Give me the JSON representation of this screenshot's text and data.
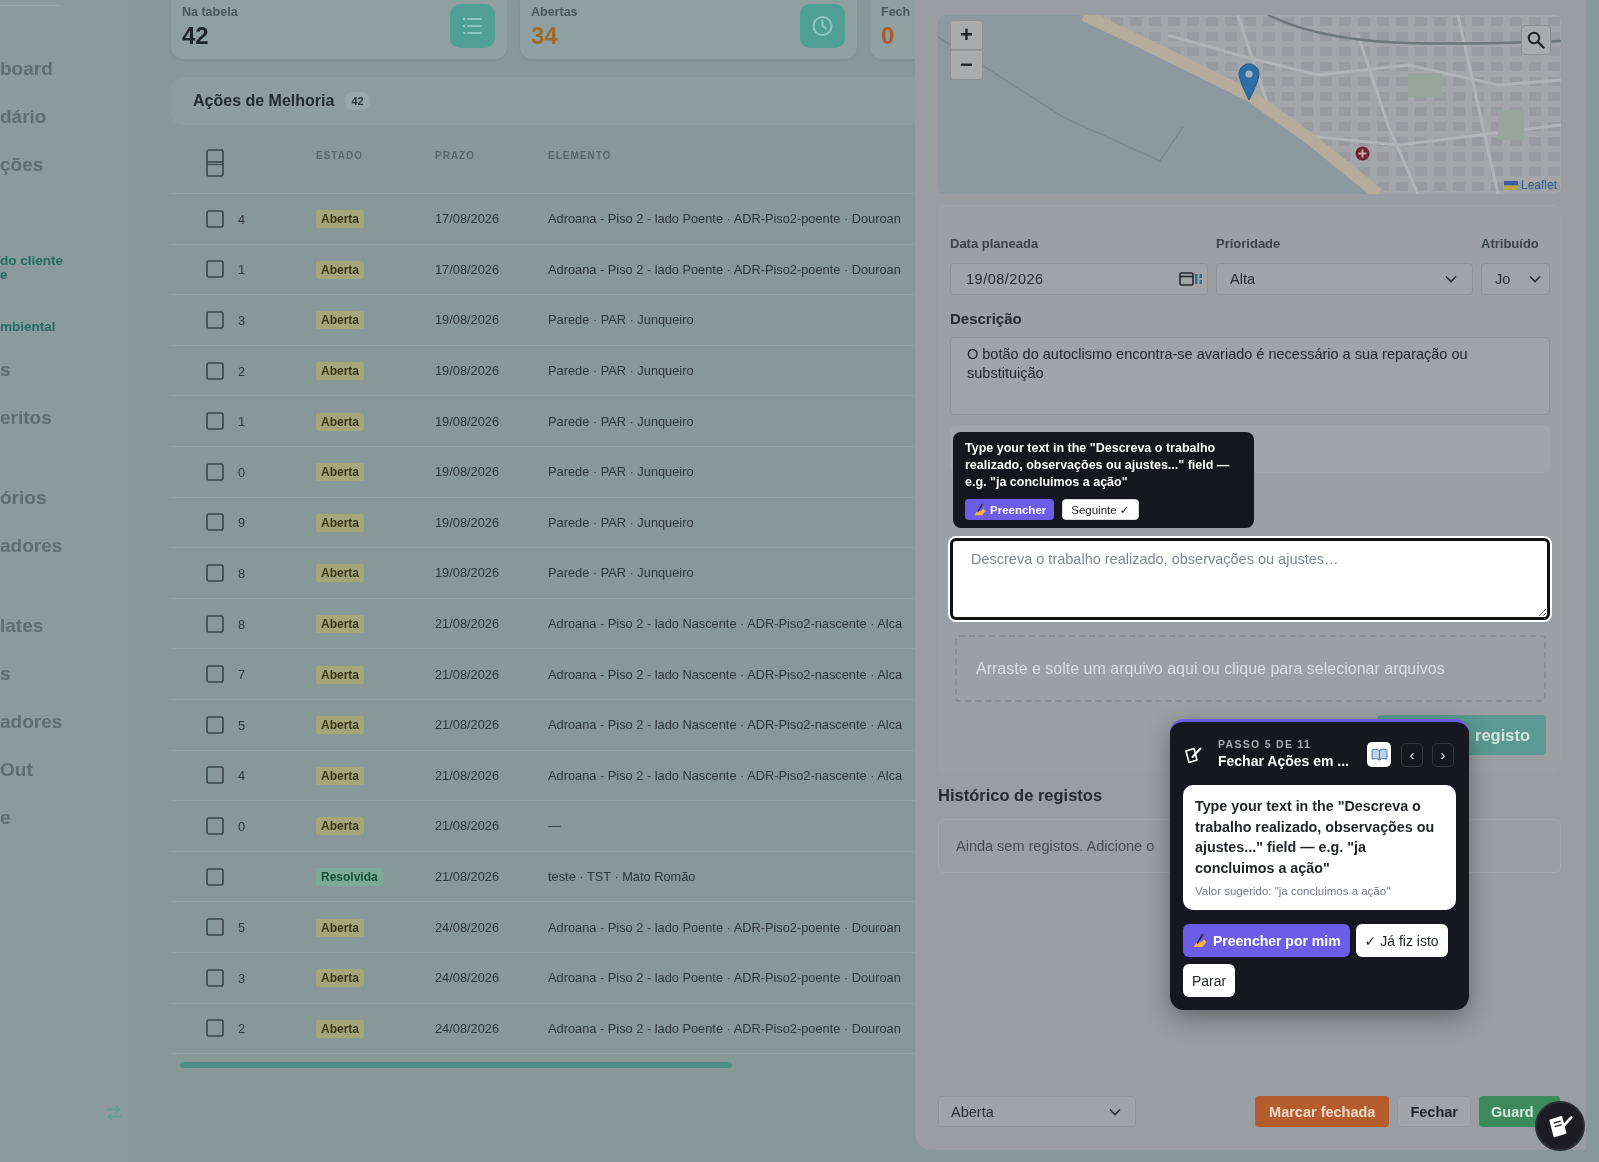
{
  "sidebar": {
    "groups": [
      {
        "items": [
          {
            "kind": "main",
            "lines": [
              "board"
            ]
          },
          {
            "kind": "main",
            "lines": [
              "dário"
            ]
          },
          {
            "kind": "main",
            "lines": [
              "ções"
            ]
          }
        ]
      },
      {
        "items": [
          {
            "kind": "sub",
            "lines": [
              "do cliente",
              "e"
            ]
          },
          {
            "kind": "sub",
            "lines": [
              "mbiental"
            ]
          },
          {
            "kind": "main",
            "lines": [
              "s"
            ]
          },
          {
            "kind": "main",
            "lines": [
              "eritos"
            ]
          }
        ]
      },
      {
        "items": [
          {
            "kind": "main",
            "lines": [
              "órios"
            ]
          },
          {
            "kind": "main",
            "lines": [
              "adores"
            ]
          }
        ]
      },
      {
        "items": [
          {
            "kind": "main",
            "lines": [
              "lates"
            ]
          },
          {
            "kind": "main",
            "lines": [
              "s"
            ]
          },
          {
            "kind": "main",
            "lines": [
              "adores"
            ]
          },
          {
            "kind": "main",
            "lines": [
              "Out"
            ]
          },
          {
            "kind": "main",
            "lines": [
              "e"
            ]
          }
        ]
      }
    ]
  },
  "stats": [
    {
      "kind": "total",
      "label": "Na tabela",
      "value": "42"
    },
    {
      "kind": "open",
      "label": "Abertas",
      "value": "34"
    },
    {
      "kind": "closed",
      "label": "Fech",
      "value": "0"
    }
  ],
  "actions": {
    "title": "Ações de Melhoria",
    "count": "42",
    "table": {
      "select_all_checked": false,
      "columns": [
        "ESTADO",
        "PRAZO",
        "ELEMENTO"
      ],
      "rows": [
        {
          "id": "4",
          "checked": false,
          "status": {
            "label": "Aberta",
            "kind": "open"
          },
          "due": "17/08/2026",
          "element": "Adroana - Piso 2 - lado Poente · ADR-Piso2-poente · Douroan"
        },
        {
          "id": "1",
          "checked": false,
          "status": {
            "label": "Aberta",
            "kind": "open"
          },
          "due": "17/08/2026",
          "element": "Adroana - Piso 2 - lado Poente · ADR-Piso2-poente · Douroan"
        },
        {
          "id": "3",
          "checked": false,
          "status": {
            "label": "Aberta",
            "kind": "open"
          },
          "due": "19/08/2026",
          "element": "Parede · PAR · Junqueiro"
        },
        {
          "id": "2",
          "checked": false,
          "status": {
            "label": "Aberta",
            "kind": "open"
          },
          "due": "19/08/2026",
          "element": "Parede · PAR · Junqueiro"
        },
        {
          "id": "1",
          "checked": false,
          "status": {
            "label": "Aberta",
            "kind": "open"
          },
          "due": "19/08/2026",
          "element": "Parede · PAR · Junqueiro"
        },
        {
          "id": "0",
          "checked": false,
          "status": {
            "label": "Aberta",
            "kind": "open"
          },
          "due": "19/08/2026",
          "element": "Parede · PAR · Junqueiro"
        },
        {
          "id": "9",
          "checked": false,
          "status": {
            "label": "Aberta",
            "kind": "open"
          },
          "due": "19/08/2026",
          "element": "Parede · PAR · Junqueiro"
        },
        {
          "id": "8",
          "checked": false,
          "status": {
            "label": "Aberta",
            "kind": "open"
          },
          "due": "19/08/2026",
          "element": "Parede · PAR · Junqueiro"
        },
        {
          "id": "8",
          "checked": false,
          "status": {
            "label": "Aberta",
            "kind": "open"
          },
          "due": "21/08/2026",
          "element": "Adroana - Piso 2 - lado Nascente · ADR-Piso2-nascente · Alca"
        },
        {
          "id": "7",
          "checked": false,
          "status": {
            "label": "Aberta",
            "kind": "open"
          },
          "due": "21/08/2026",
          "element": "Adroana - Piso 2 - lado Nascente · ADR-Piso2-nascente · Alca"
        },
        {
          "id": "5",
          "checked": false,
          "status": {
            "label": "Aberta",
            "kind": "open"
          },
          "due": "21/08/2026",
          "element": "Adroana - Piso 2 - lado Nascente · ADR-Piso2-nascente · Alca"
        },
        {
          "id": "4",
          "checked": false,
          "status": {
            "label": "Aberta",
            "kind": "open"
          },
          "due": "21/08/2026",
          "element": "Adroana - Piso 2 - lado Nascente · ADR-Piso2-nascente · Alca"
        },
        {
          "id": "0",
          "checked": false,
          "status": {
            "label": "Aberta",
            "kind": "open"
          },
          "due": "21/08/2026",
          "element": "—"
        },
        {
          "checked": false,
          "status": {
            "label": "Resolvida",
            "kind": "resolved"
          },
          "due": "21/08/2026",
          "element": "teste · TST · Mato Romão"
        },
        {
          "id": "5",
          "checked": false,
          "status": {
            "label": "Aberta",
            "kind": "open"
          },
          "due": "24/08/2026",
          "element": "Adroana - Piso 2 - lado Poente · ADR-Piso2-poente · Douroan"
        },
        {
          "id": "3",
          "checked": false,
          "status": {
            "label": "Aberta",
            "kind": "open"
          },
          "due": "24/08/2026",
          "element": "Adroana - Piso 2 - lado Poente · ADR-Piso2-poente · Douroan"
        },
        {
          "id": "2",
          "checked": false,
          "status": {
            "label": "Aberta",
            "kind": "open"
          },
          "due": "24/08/2026",
          "element": "Adroana - Piso 2 - lado Poente · ADR-Piso2-poente · Douroan"
        }
      ]
    }
  },
  "drawer": {
    "map": {
      "zoom_in": "+",
      "zoom_out": "−",
      "attribution": "Leaflet"
    },
    "form": {
      "fields": [
        {
          "label": "Data planeada",
          "value": "19/08/2026",
          "kind": "date"
        },
        {
          "label": "Prioridade",
          "value": "Alta",
          "kind": "select"
        },
        {
          "label": "Atribuído",
          "value": "Jo",
          "kind": "select"
        }
      ],
      "description": {
        "label": "Descrição",
        "value": "O botão do autoclismo encontra-se avariado é necessário a sua reparação ou substituição"
      },
      "work_note": {
        "placeholder": "Descreva o trabalho realizado, observações ou ajustes…",
        "highlighted": true
      },
      "dropzone": "Arraste e solte um arquivo aqui ou clique para selecionar arquivos",
      "add_button": "registo"
    },
    "history": {
      "title": "Histórico de registos",
      "empty_text": "Ainda sem registos. Adicione o"
    },
    "footer": {
      "status": "Aberta",
      "buttons": [
        {
          "label": "Marcar fechada",
          "kind": "warning"
        },
        {
          "label": "Fechar",
          "kind": "plain"
        },
        {
          "label": "Guard",
          "kind": "success"
        }
      ]
    }
  },
  "tour_hint": {
    "text": "Type your text in the \"Descreva o trabalho realizado, observações ou ajustes...\" field — e.g. \"ja concluimos a ação\"",
    "buttons": [
      {
        "label": "Preencher",
        "kind": "primary"
      },
      {
        "label": "Seguinte ✓",
        "kind": "secondary"
      }
    ]
  },
  "tour_step": {
    "step": "PASSO 5 DE 11",
    "title": "Fechar Ações em ...",
    "prev": "‹",
    "next": "›",
    "instruction": "Type your text in the \"Descreva o trabalho realizado, observações ou ajustes...\" field — e.g. \"ja concluimos a ação\"",
    "suggestion": "Valor sugerido: \"ja concluimos a ação\"",
    "buttons": [
      {
        "label": "Preencher por mim",
        "kind": "primary"
      },
      {
        "label": "✓ Já fiz isto",
        "kind": "secondary"
      },
      {
        "label": "Parar",
        "kind": "secondary"
      }
    ]
  }
}
